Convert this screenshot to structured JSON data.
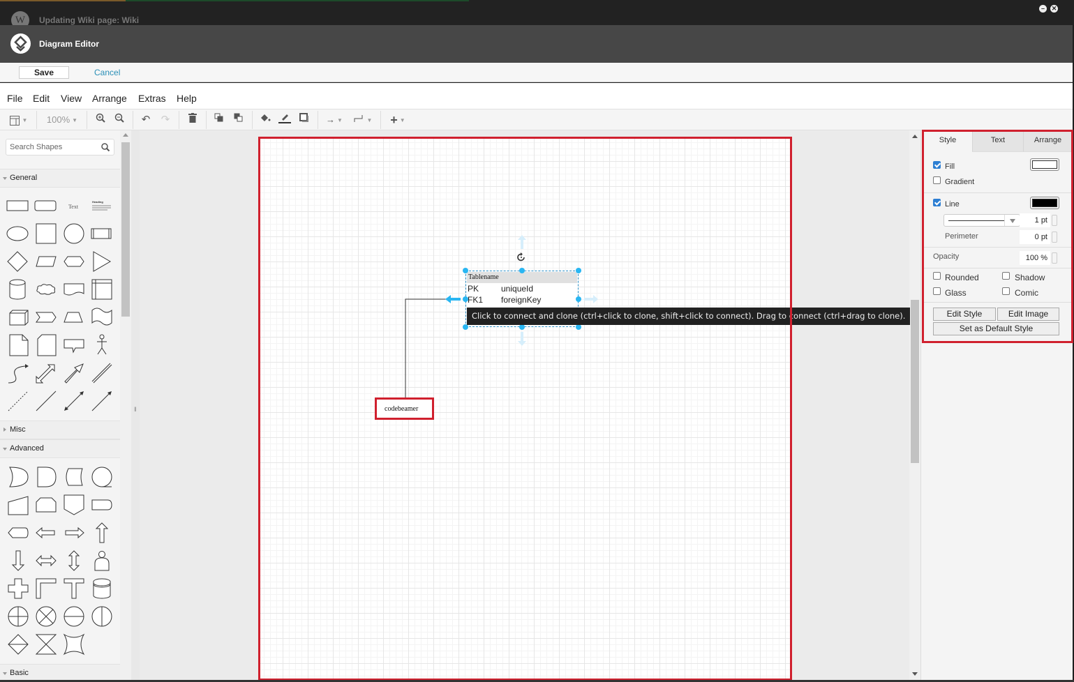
{
  "window": {
    "wiki_title": "Updating Wiki page: Wiki",
    "wiki_logo_letter": "W",
    "minimize_icon": "minimize-icon",
    "close_icon": "close-icon"
  },
  "dialog": {
    "title": "Diagram Editor",
    "save_label": "Save",
    "cancel_label": "Cancel"
  },
  "menu": [
    "File",
    "Edit",
    "View",
    "Arrange",
    "Extras",
    "Help"
  ],
  "toolbar": {
    "zoom_level": "100%",
    "items": [
      "format-panel-toggle",
      "zoom-in",
      "zoom-out",
      "undo",
      "redo",
      "delete",
      "to-front",
      "to-back",
      "fill-color",
      "line-color",
      "shadow",
      "connection-style",
      "waypoints",
      "insert"
    ]
  },
  "sidebar": {
    "search_placeholder": "Search Shapes",
    "sections": [
      {
        "label": "General",
        "expanded": true
      },
      {
        "label": "Misc",
        "expanded": false
      },
      {
        "label": "Advanced",
        "expanded": true
      },
      {
        "label": "Basic",
        "expanded": true
      }
    ],
    "text_shape_label": "Text",
    "heading_shape_label": "Heading"
  },
  "diagram": {
    "entity": {
      "title": "Tablename",
      "rows": [
        {
          "key": "PK",
          "name": "uniqueId"
        },
        {
          "key": "FK1",
          "name": "foreignKey"
        }
      ]
    },
    "target_label": "codebeamer",
    "tooltip": "Click to connect and clone (ctrl+click to clone, shift+click to connect). Drag to connect (ctrl+drag to clone)."
  },
  "format_panel": {
    "tabs": [
      "Style",
      "Text",
      "Arrange"
    ],
    "active_tab": "Style",
    "fill": {
      "label": "Fill",
      "checked": true,
      "color": "#ffffff"
    },
    "gradient": {
      "label": "Gradient",
      "checked": false
    },
    "line": {
      "label": "Line",
      "checked": true,
      "color": "#000000",
      "width": "1 pt"
    },
    "perimeter": {
      "label": "Perimeter",
      "value": "0 pt"
    },
    "opacity": {
      "label": "Opacity",
      "value": "100 %"
    },
    "options": [
      {
        "label": "Rounded",
        "checked": false
      },
      {
        "label": "Shadow",
        "checked": false
      },
      {
        "label": "Glass",
        "checked": false
      },
      {
        "label": "Comic",
        "checked": false
      }
    ],
    "buttons": {
      "edit_style": "Edit Style",
      "edit_image": "Edit Image",
      "set_default": "Set as Default Style"
    }
  },
  "colors": {
    "highlight": "#d0202e",
    "selection": "#29b6f2",
    "link": "#2a8fb7",
    "header_bg": "#474747"
  }
}
